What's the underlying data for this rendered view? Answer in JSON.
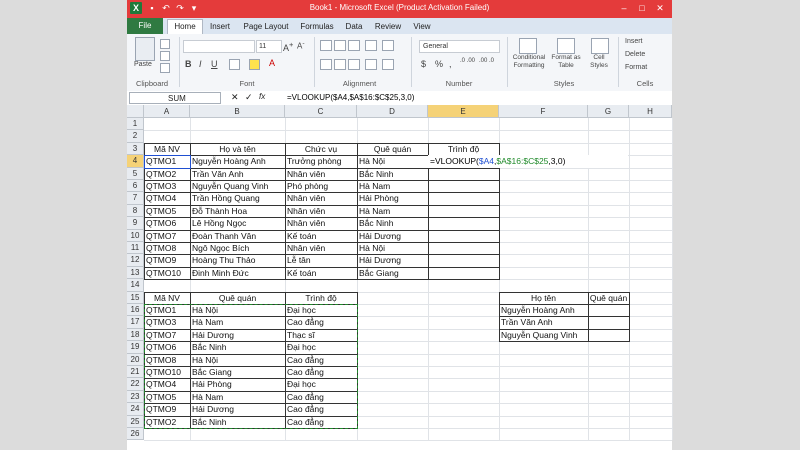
{
  "window": {
    "title": "Book1 - Microsoft Excel (Product Activation Failed)",
    "buttons": [
      "–",
      "□",
      "✕"
    ]
  },
  "quick_access": {
    "logo": "X",
    "icons": [
      "save-icon",
      "undo-icon",
      "redo-icon",
      "customize-icon"
    ]
  },
  "ribbon": {
    "tabs": [
      "File",
      "Home",
      "Insert",
      "Page Layout",
      "Formulas",
      "Data",
      "Review",
      "View"
    ],
    "active_tab": "Home",
    "groups": {
      "clipboard": {
        "label": "Clipboard",
        "paste": "Paste"
      },
      "font": {
        "label": "Font",
        "size": "11",
        "bold": "B",
        "italic": "I",
        "underline": "U"
      },
      "alignment": {
        "label": "Alignment"
      },
      "number": {
        "label": "Number",
        "format": "General",
        "dollar": "$",
        "percent": "%",
        "comma": ",",
        "inc_dec": ".0 .00",
        "dec_dec": ".00 .0"
      },
      "styles": {
        "label": "Styles",
        "conditional": "Conditional Formatting",
        "format_table": "Format as Table",
        "cell_styles": "Cell Styles"
      },
      "cells": {
        "label": "Cells",
        "insert": "Insert",
        "delete": "Delete",
        "format": "Format"
      }
    }
  },
  "formula_bar": {
    "name_box": "SUM",
    "fx": "fx",
    "formula": "=VLOOKUP($A4,$A$16:$C$25,3,0)"
  },
  "grid": {
    "columns": [
      "A",
      "B",
      "C",
      "D",
      "E",
      "F",
      "G",
      "H"
    ],
    "rows": [
      "1",
      "2",
      "3",
      "4",
      "5",
      "6",
      "7",
      "8",
      "9",
      "10",
      "11",
      "12",
      "13",
      "14",
      "15",
      "16",
      "17",
      "18",
      "19",
      "20",
      "21",
      "22",
      "23",
      "24",
      "25",
      "26"
    ]
  },
  "table1": {
    "headers": [
      "Mã NV",
      "Họ và tên",
      "Chức vụ",
      "Quê quán",
      "Trình độ"
    ],
    "rows": [
      [
        "QTMO1",
        "Nguyễn Hoàng Anh",
        "Trưởng phòng",
        "Hà Nội"
      ],
      [
        "QTMO2",
        "Trần Văn Anh",
        "Nhân viên",
        "Bắc Ninh"
      ],
      [
        "QTMO3",
        "Nguyễn Quang Vinh",
        "Phó phòng",
        "Hà Nam"
      ],
      [
        "QTMO4",
        "Trần Hồng Quang",
        "Nhân viên",
        "Hải Phòng"
      ],
      [
        "QTMO5",
        "Đỗ Thành Hoa",
        "Nhân viên",
        "Hà Nam"
      ],
      [
        "QTMO6",
        "Lê Hồng Ngọc",
        "Nhân viên",
        "Bắc Ninh"
      ],
      [
        "QTMO7",
        "Đoàn Thanh Vân",
        "Kế toán",
        "Hải Dương"
      ],
      [
        "QTMO8",
        "Ngô Ngọc Bích",
        "Nhân viên",
        "Hà Nội"
      ],
      [
        "QTMO9",
        "Hoàng Thu Thảo",
        "Lễ tân",
        "Hải Dương"
      ],
      [
        "QTMO10",
        "Đinh Minh Đức",
        "Kế toán",
        "Bắc Giang"
      ]
    ],
    "edit_cell": {
      "prefix": "=VLOOKUP(",
      "ref1": "$A4",
      "comma1": ",",
      "ref2": "$A$16:$C$25",
      "suffix": ",3,0)"
    }
  },
  "table2": {
    "headers": [
      "Mã NV",
      "Quê quán",
      "Trình độ"
    ],
    "rows": [
      [
        "QTMO1",
        "Hà Nội",
        "Đại học"
      ],
      [
        "QTMO3",
        "Hà Nam",
        "Cao đẳng"
      ],
      [
        "QTMO7",
        "Hải Dương",
        "Thạc sĩ"
      ],
      [
        "QTMO6",
        "Bắc Ninh",
        "Đại học"
      ],
      [
        "QTMO8",
        "Hà Nội",
        "Cao đẳng"
      ],
      [
        "QTMO10",
        "Bắc Giang",
        "Cao đẳng"
      ],
      [
        "QTMO4",
        "Hải Phòng",
        "Đại học"
      ],
      [
        "QTMO5",
        "Hà Nam",
        "Cao đẳng"
      ],
      [
        "QTMO9",
        "Hải Dương",
        "Cao đẳng"
      ],
      [
        "QTMO2",
        "Bắc Ninh",
        "Cao đẳng"
      ]
    ]
  },
  "table3": {
    "headers": [
      "Họ tên",
      "Quê quán"
    ],
    "rows": [
      [
        "Nguyễn Hoàng Anh",
        ""
      ],
      [
        "Trần Văn Anh",
        ""
      ],
      [
        "Nguyễn Quang Vinh",
        ""
      ]
    ]
  },
  "colors": {
    "title_bar": "#e43b3b",
    "file_tab": "#2f7a41",
    "ref1": "#1f4fd1",
    "ref2": "#1f8a2a",
    "selected_header": "#f5d277"
  }
}
